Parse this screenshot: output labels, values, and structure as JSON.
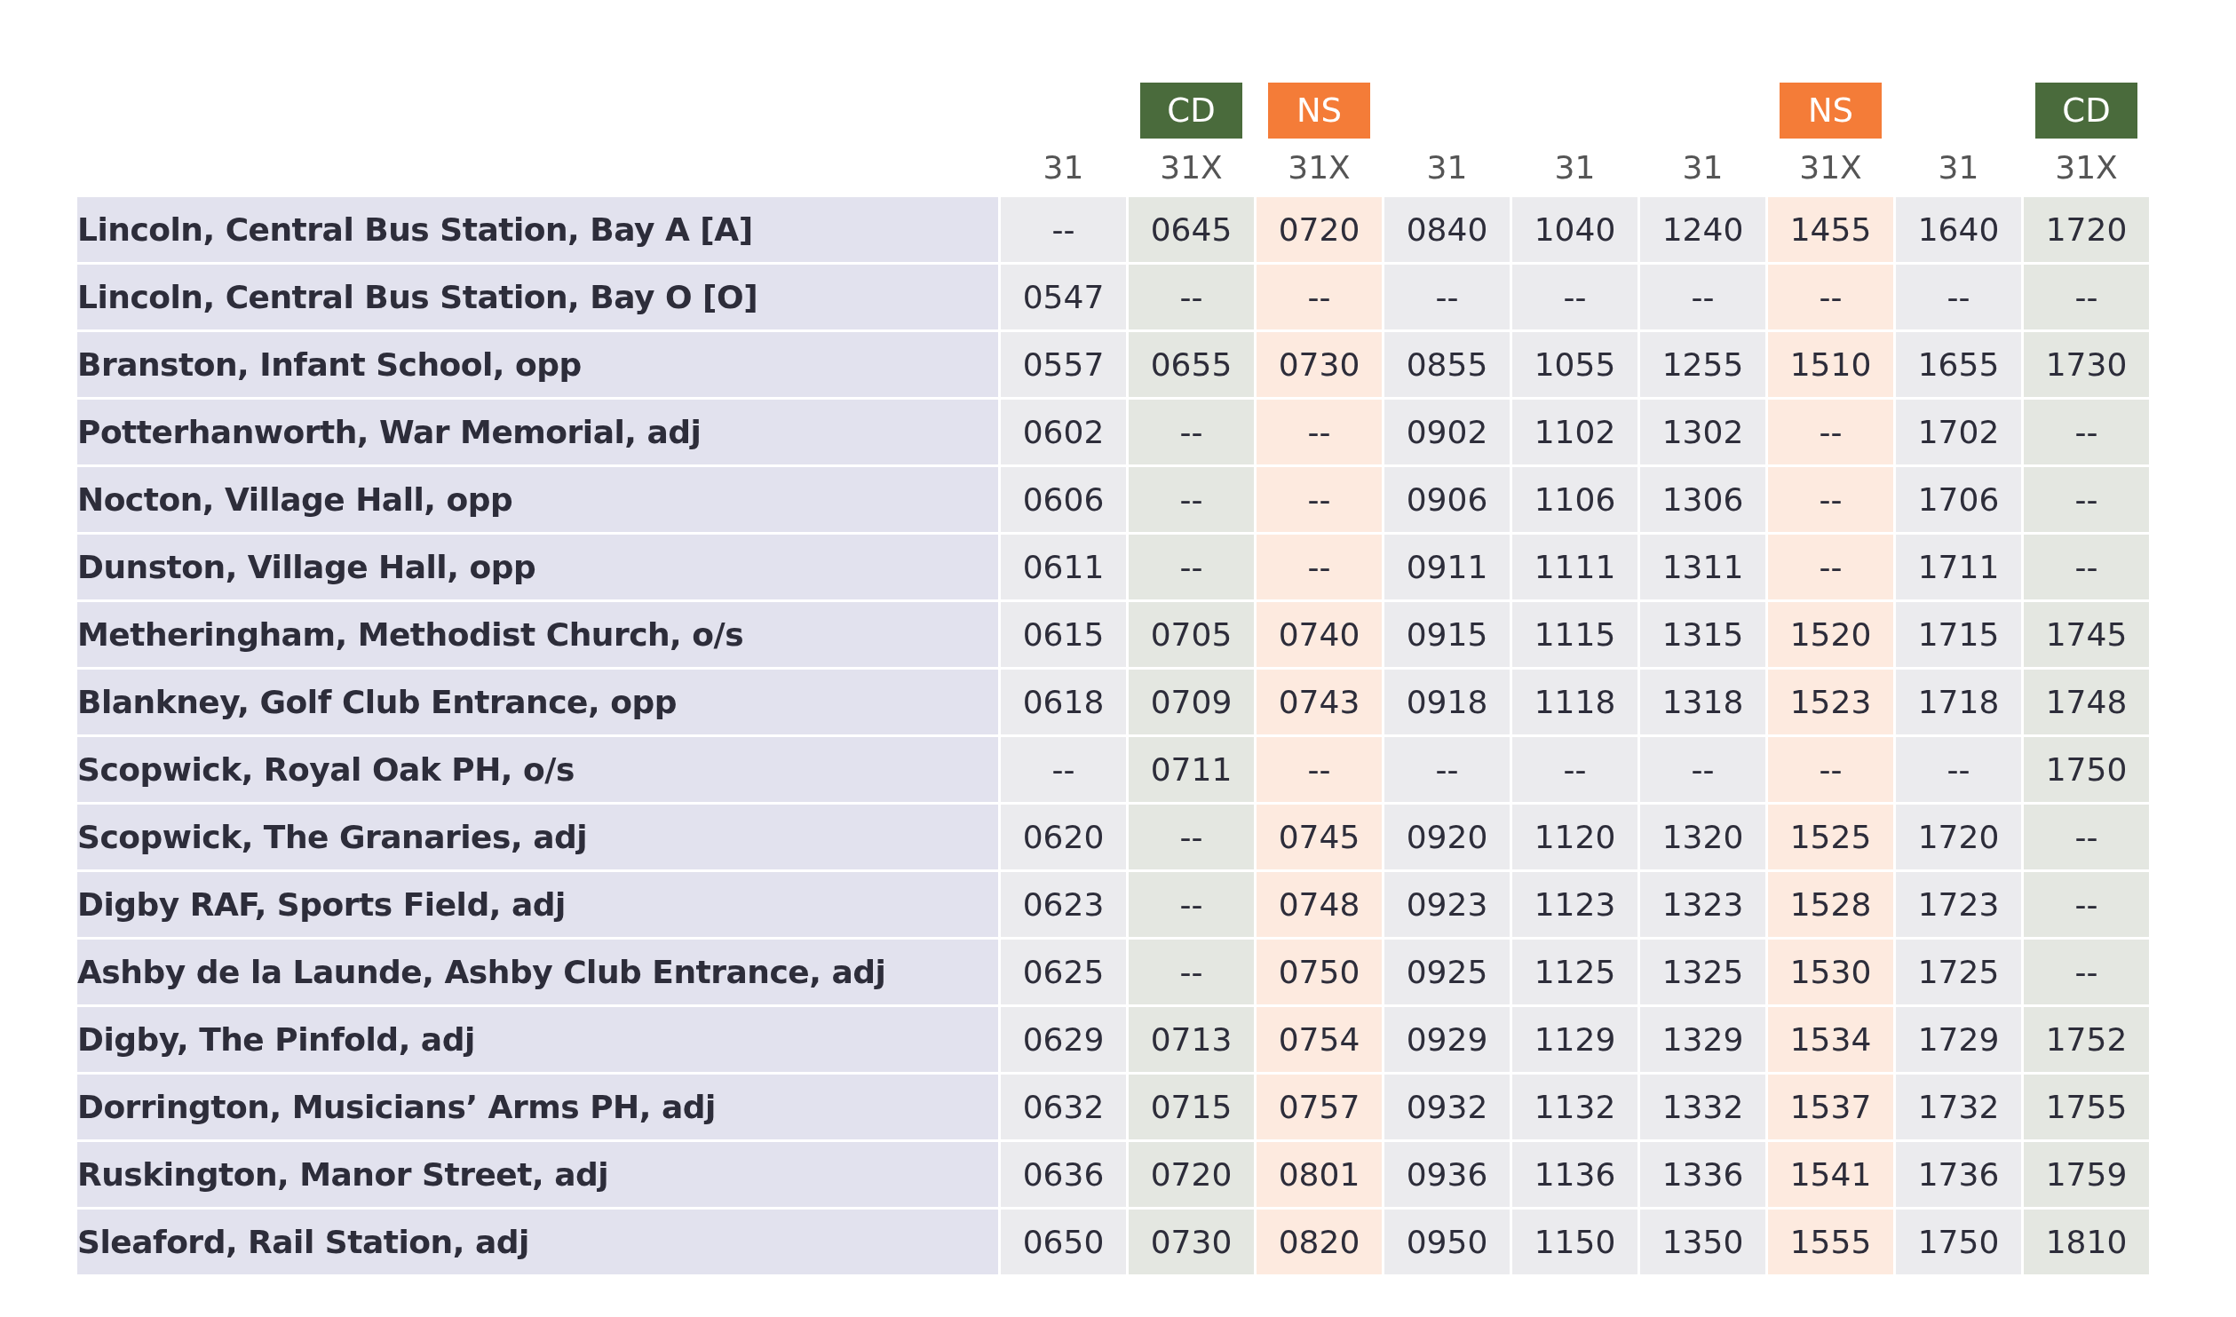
{
  "columns": [
    {
      "route": "31"
    },
    {
      "route": "31X",
      "badge": {
        "text": "CD",
        "kind": "cd"
      }
    },
    {
      "route": "31X",
      "badge": {
        "text": "NS",
        "kind": "ns"
      }
    },
    {
      "route": "31"
    },
    {
      "route": "31"
    },
    {
      "route": "31"
    },
    {
      "route": "31X",
      "badge": {
        "text": "NS",
        "kind": "ns"
      }
    },
    {
      "route": "31"
    },
    {
      "route": "31X",
      "badge": {
        "text": "CD",
        "kind": "cd"
      }
    }
  ],
  "rows": [
    {
      "stop": "Lincoln, Central Bus Station, Bay A [A]",
      "times": [
        "--",
        "0645",
        "0720",
        "0840",
        "1040",
        "1240",
        "1455",
        "1640",
        "1720"
      ]
    },
    {
      "stop": "Lincoln, Central Bus Station, Bay O [O]",
      "times": [
        "0547",
        "--",
        "--",
        "--",
        "--",
        "--",
        "--",
        "--",
        "--"
      ]
    },
    {
      "stop": "Branston, Infant School, opp",
      "times": [
        "0557",
        "0655",
        "0730",
        "0855",
        "1055",
        "1255",
        "1510",
        "1655",
        "1730"
      ]
    },
    {
      "stop": "Potterhanworth, War Memorial, adj",
      "times": [
        "0602",
        "--",
        "--",
        "0902",
        "1102",
        "1302",
        "--",
        "1702",
        "--"
      ]
    },
    {
      "stop": "Nocton, Village Hall, opp",
      "times": [
        "0606",
        "--",
        "--",
        "0906",
        "1106",
        "1306",
        "--",
        "1706",
        "--"
      ]
    },
    {
      "stop": "Dunston, Village Hall, opp",
      "times": [
        "0611",
        "--",
        "--",
        "0911",
        "1111",
        "1311",
        "--",
        "1711",
        "--"
      ]
    },
    {
      "stop": "Metheringham, Methodist Church, o/s",
      "times": [
        "0615",
        "0705",
        "0740",
        "0915",
        "1115",
        "1315",
        "1520",
        "1715",
        "1745"
      ]
    },
    {
      "stop": "Blankney, Golf Club Entrance, opp",
      "times": [
        "0618",
        "0709",
        "0743",
        "0918",
        "1118",
        "1318",
        "1523",
        "1718",
        "1748"
      ]
    },
    {
      "stop": "Scopwick, Royal Oak PH, o/s",
      "times": [
        "--",
        "0711",
        "--",
        "--",
        "--",
        "--",
        "--",
        "--",
        "1750"
      ]
    },
    {
      "stop": "Scopwick, The Granaries, adj",
      "times": [
        "0620",
        "--",
        "0745",
        "0920",
        "1120",
        "1320",
        "1525",
        "1720",
        "--"
      ]
    },
    {
      "stop": "Digby RAF, Sports Field, adj",
      "times": [
        "0623",
        "--",
        "0748",
        "0923",
        "1123",
        "1323",
        "1528",
        "1723",
        "--"
      ]
    },
    {
      "stop": "Ashby de la Launde, Ashby Club Entrance, adj",
      "times": [
        "0625",
        "--",
        "0750",
        "0925",
        "1125",
        "1325",
        "1530",
        "1725",
        "--"
      ]
    },
    {
      "stop": "Digby, The Pinfold, adj",
      "times": [
        "0629",
        "0713",
        "0754",
        "0929",
        "1129",
        "1329",
        "1534",
        "1729",
        "1752"
      ]
    },
    {
      "stop": "Dorrington, Musicians’ Arms PH, adj",
      "times": [
        "0632",
        "0715",
        "0757",
        "0932",
        "1132",
        "1332",
        "1537",
        "1732",
        "1755"
      ]
    },
    {
      "stop": "Ruskington, Manor Street, adj",
      "times": [
        "0636",
        "0720",
        "0801",
        "0936",
        "1136",
        "1336",
        "1541",
        "1736",
        "1759"
      ]
    },
    {
      "stop": "Sleaford, Rail Station, adj",
      "times": [
        "0650",
        "0730",
        "0820",
        "0950",
        "1150",
        "1350",
        "1555",
        "1750",
        "1810"
      ]
    }
  ]
}
